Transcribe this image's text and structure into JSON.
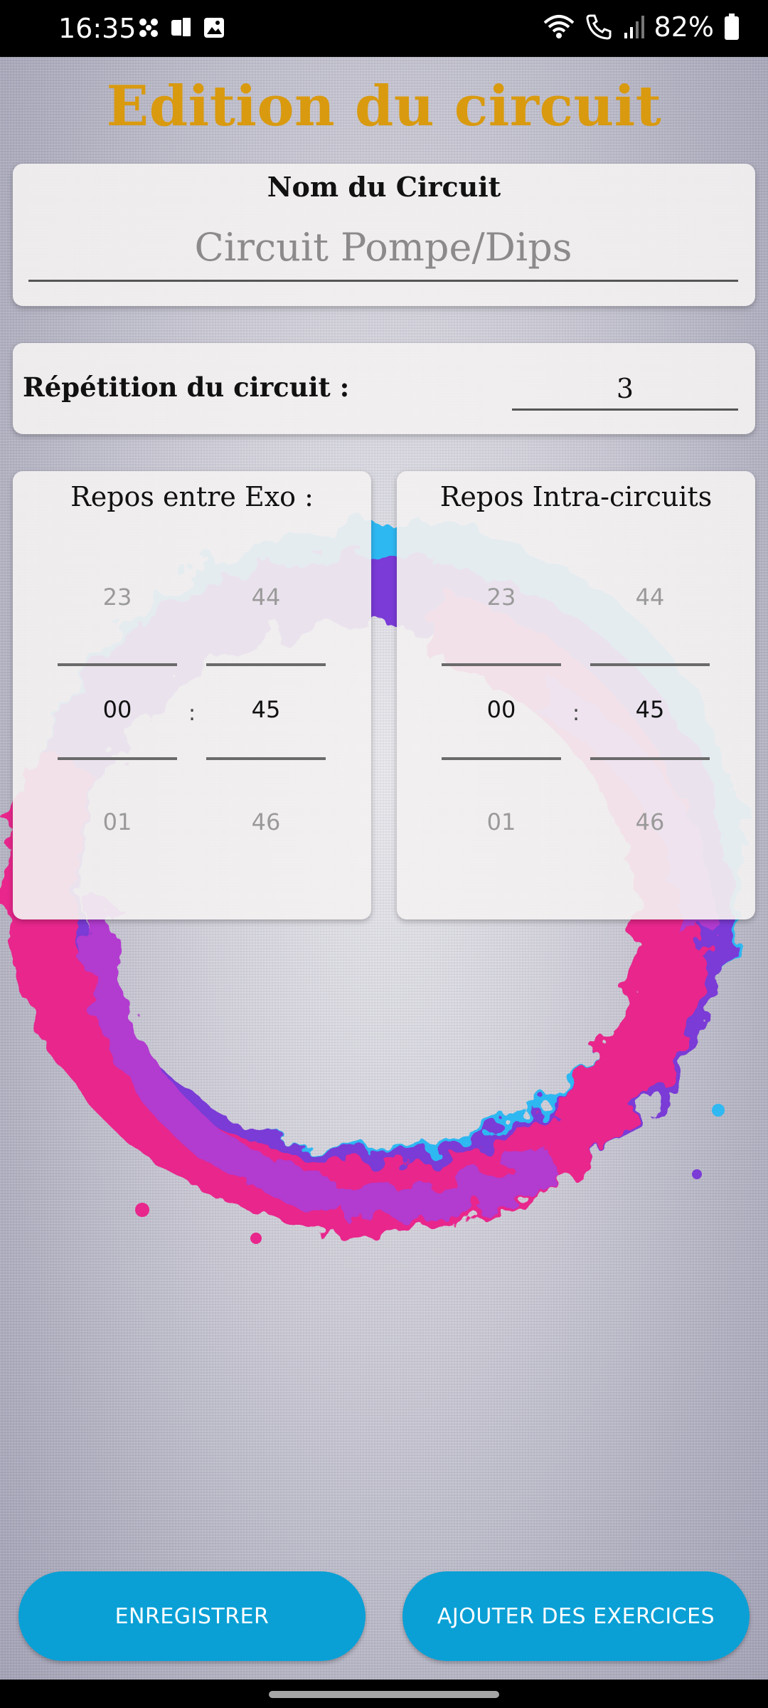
{
  "status_bar": {
    "time": "16:35",
    "battery": "82%",
    "icons_left": [
      "fan-icon",
      "device-icon",
      "image-icon"
    ],
    "icons_right": [
      "wifi-icon",
      "call-icon",
      "signal-icon",
      "battery-icon"
    ]
  },
  "title": "Edition du circuit",
  "circuit_name": {
    "label": "Nom du Circuit",
    "value": "Circuit Pompe/Dips"
  },
  "repetition": {
    "label": "Répétition du circuit :",
    "value": "3"
  },
  "rest_between_exercises": {
    "title": "Repos entre Exo :",
    "minutes": {
      "prev": "23",
      "selected": "00",
      "next": "01"
    },
    "seconds": {
      "prev": "44",
      "selected": "45",
      "next": "46"
    },
    "separator": ":"
  },
  "rest_intra_circuits": {
    "title": "Repos Intra-circuits",
    "minutes": {
      "prev": "23",
      "selected": "00",
      "next": "01"
    },
    "seconds": {
      "prev": "44",
      "selected": "45",
      "next": "46"
    },
    "separator": ":"
  },
  "buttons": {
    "save": "ENREGISTRER",
    "add_exercises": "AJOUTER DES EXERCICES"
  },
  "colors": {
    "title": "#d99a0f",
    "button": "#0aa0d6",
    "splash_pink": "#e8268c",
    "splash_purple": "#7a3bd6",
    "splash_blue": "#2fb8f2"
  }
}
